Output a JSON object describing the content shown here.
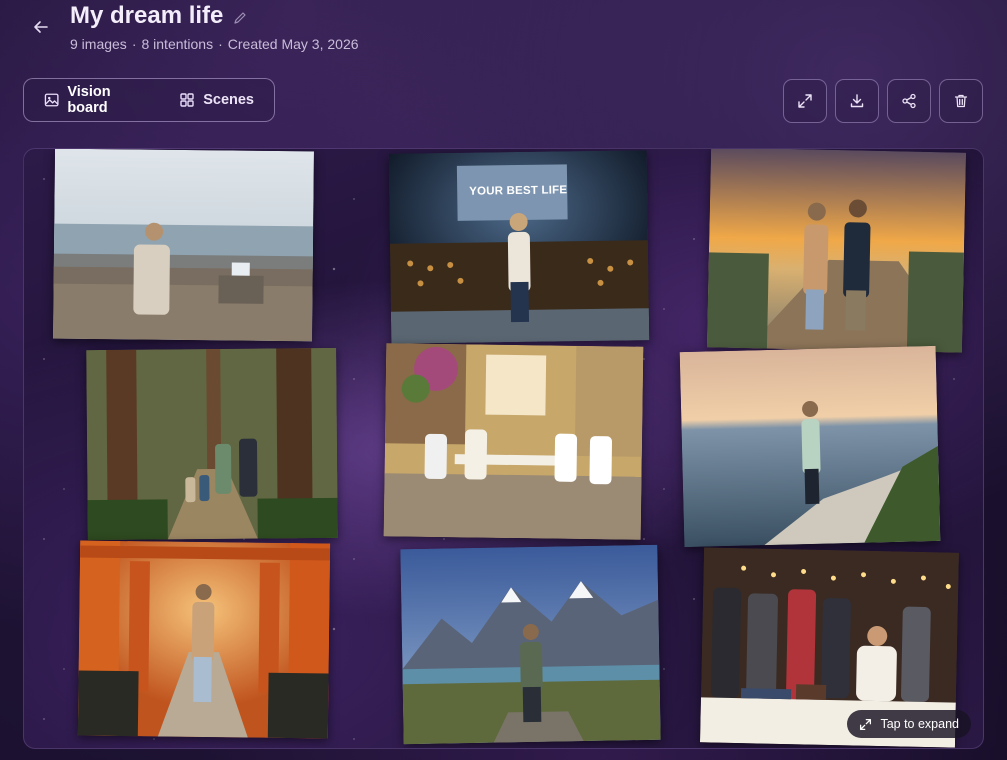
{
  "header": {
    "title": "My dream life",
    "subtitle_images": "9 images",
    "subtitle_sep1": "·",
    "subtitle_intentions": "8 intentions",
    "subtitle_sep2": "·",
    "subtitle_created": "Created May 3, 2026"
  },
  "tabs": [
    {
      "label": "Vision board",
      "icon": "image-icon",
      "active": true
    },
    {
      "label": "Scenes",
      "icon": "grid-icon",
      "active": false
    }
  ],
  "toolbar": {
    "icons": [
      "expand-icon",
      "download-icon",
      "share-icon",
      "trash-icon"
    ]
  },
  "board": {
    "photos": [
      {
        "scene": "woman relaxing on seaside deck with laptop"
      },
      {
        "scene": "woman speaking on stage before large audience",
        "banner": "YOUR BEST LIFE"
      },
      {
        "scene": "couple holding hands on boardwalk at sunset"
      },
      {
        "scene": "family walking through redwood forest"
      },
      {
        "scene": "friends dining together in courtyard"
      },
      {
        "scene": "woman standing on sea cliff at sunset"
      },
      {
        "scene": "woman walking through torii gate tunnel"
      },
      {
        "scene": "woman standing before mountain peaks"
      },
      {
        "scene": "author signing books for a crowd"
      }
    ],
    "expand_label": "Tap to expand"
  },
  "colors": {
    "background": "#1f1333",
    "accent": "#b89be0",
    "text_secondary": "#c9bcd9"
  }
}
